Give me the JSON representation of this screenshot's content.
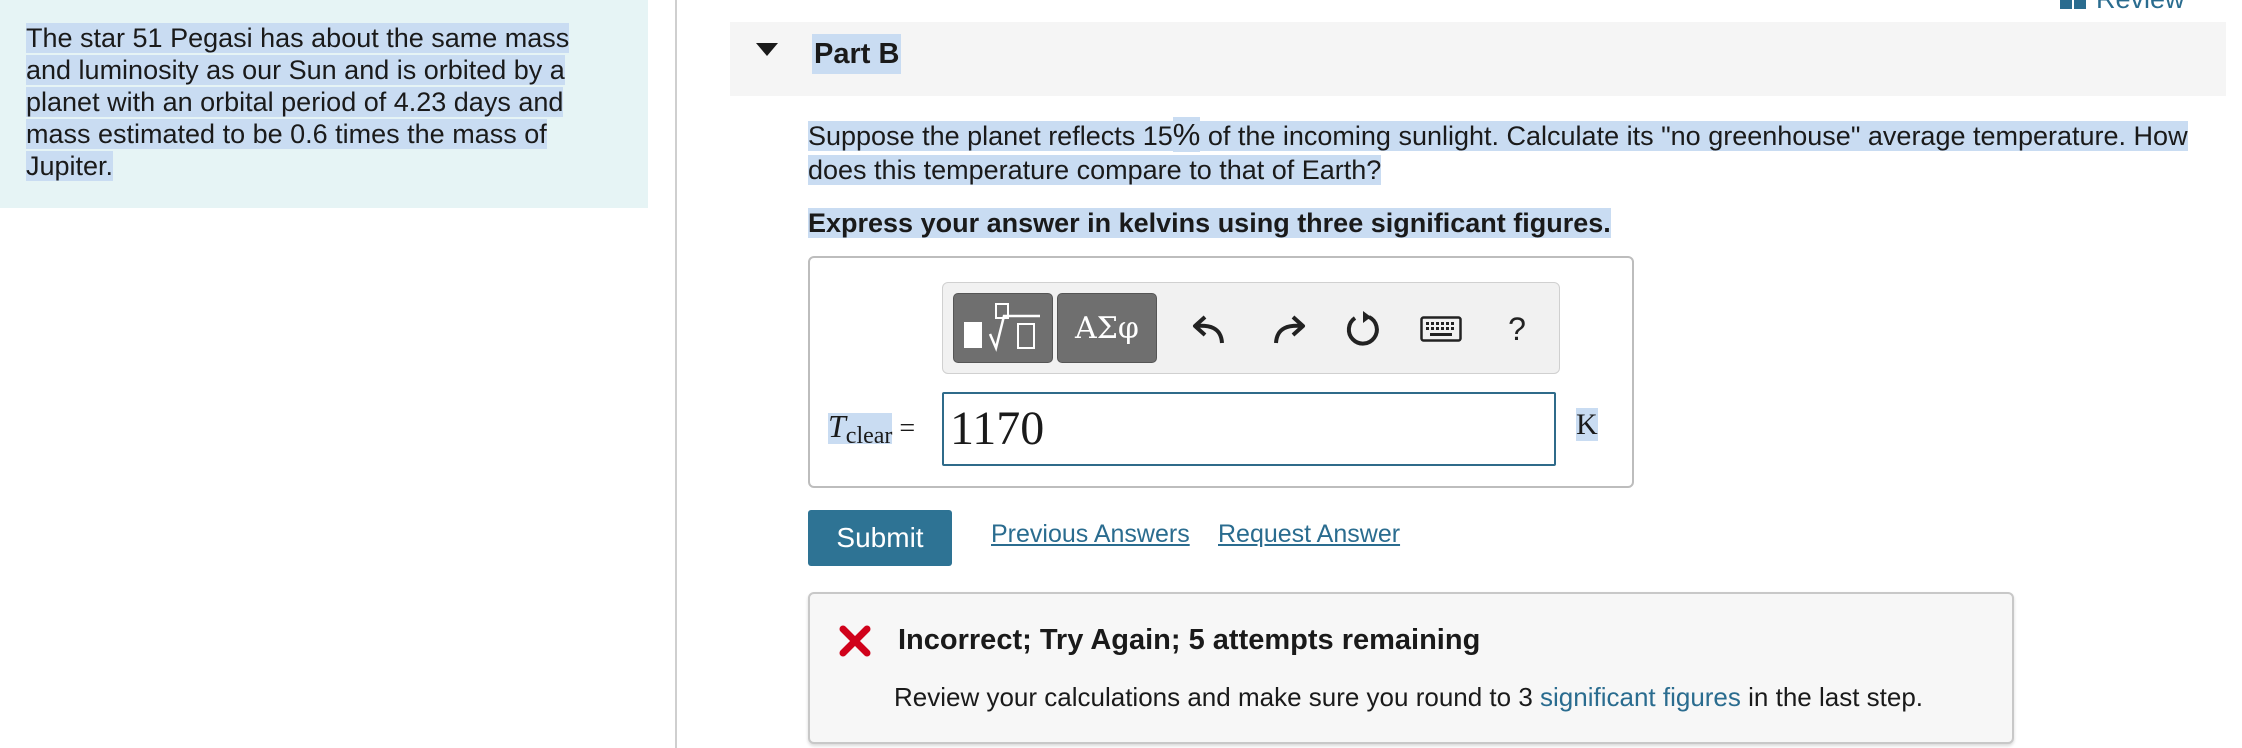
{
  "intro": {
    "text": "The star 51 Pegasi has about the same mass and luminosity as our Sun and is orbited by a planet with an orbital period of 4.23 days and mass estimated to be 0.6 times the mass of Jupiter."
  },
  "header": {
    "review_label": "Review"
  },
  "part": {
    "title": "Part B",
    "question_before": "Suppose the planet reflects 15",
    "percent_symbol": "%",
    "question_after": " of the incoming sunlight. Calculate its \"no greenhouse\" average temperature. How does this temperature compare to that of Earth?",
    "instruction": "Express your answer in kelvins using three significant figures."
  },
  "toolbar": {
    "greek_label": "ΑΣφ",
    "help_label": "?"
  },
  "answer": {
    "variable": "T",
    "subscript": "clear",
    "equals": "=",
    "value": "1170",
    "unit": "K"
  },
  "actions": {
    "submit_label": "Submit",
    "previous_answers_label": "Previous Answers",
    "request_answer_label": "Request Answer"
  },
  "feedback": {
    "title": "Incorrect; Try Again; 5 attempts remaining",
    "text_before": "Review your calculations and make sure you round to 3 ",
    "link_text": "significant figures",
    "text_after": " in the last step."
  },
  "colors": {
    "accent": "#2e7394",
    "intro_bg": "#e6f4f5",
    "error": "#d0021b",
    "selection": "#c9dcf2"
  }
}
